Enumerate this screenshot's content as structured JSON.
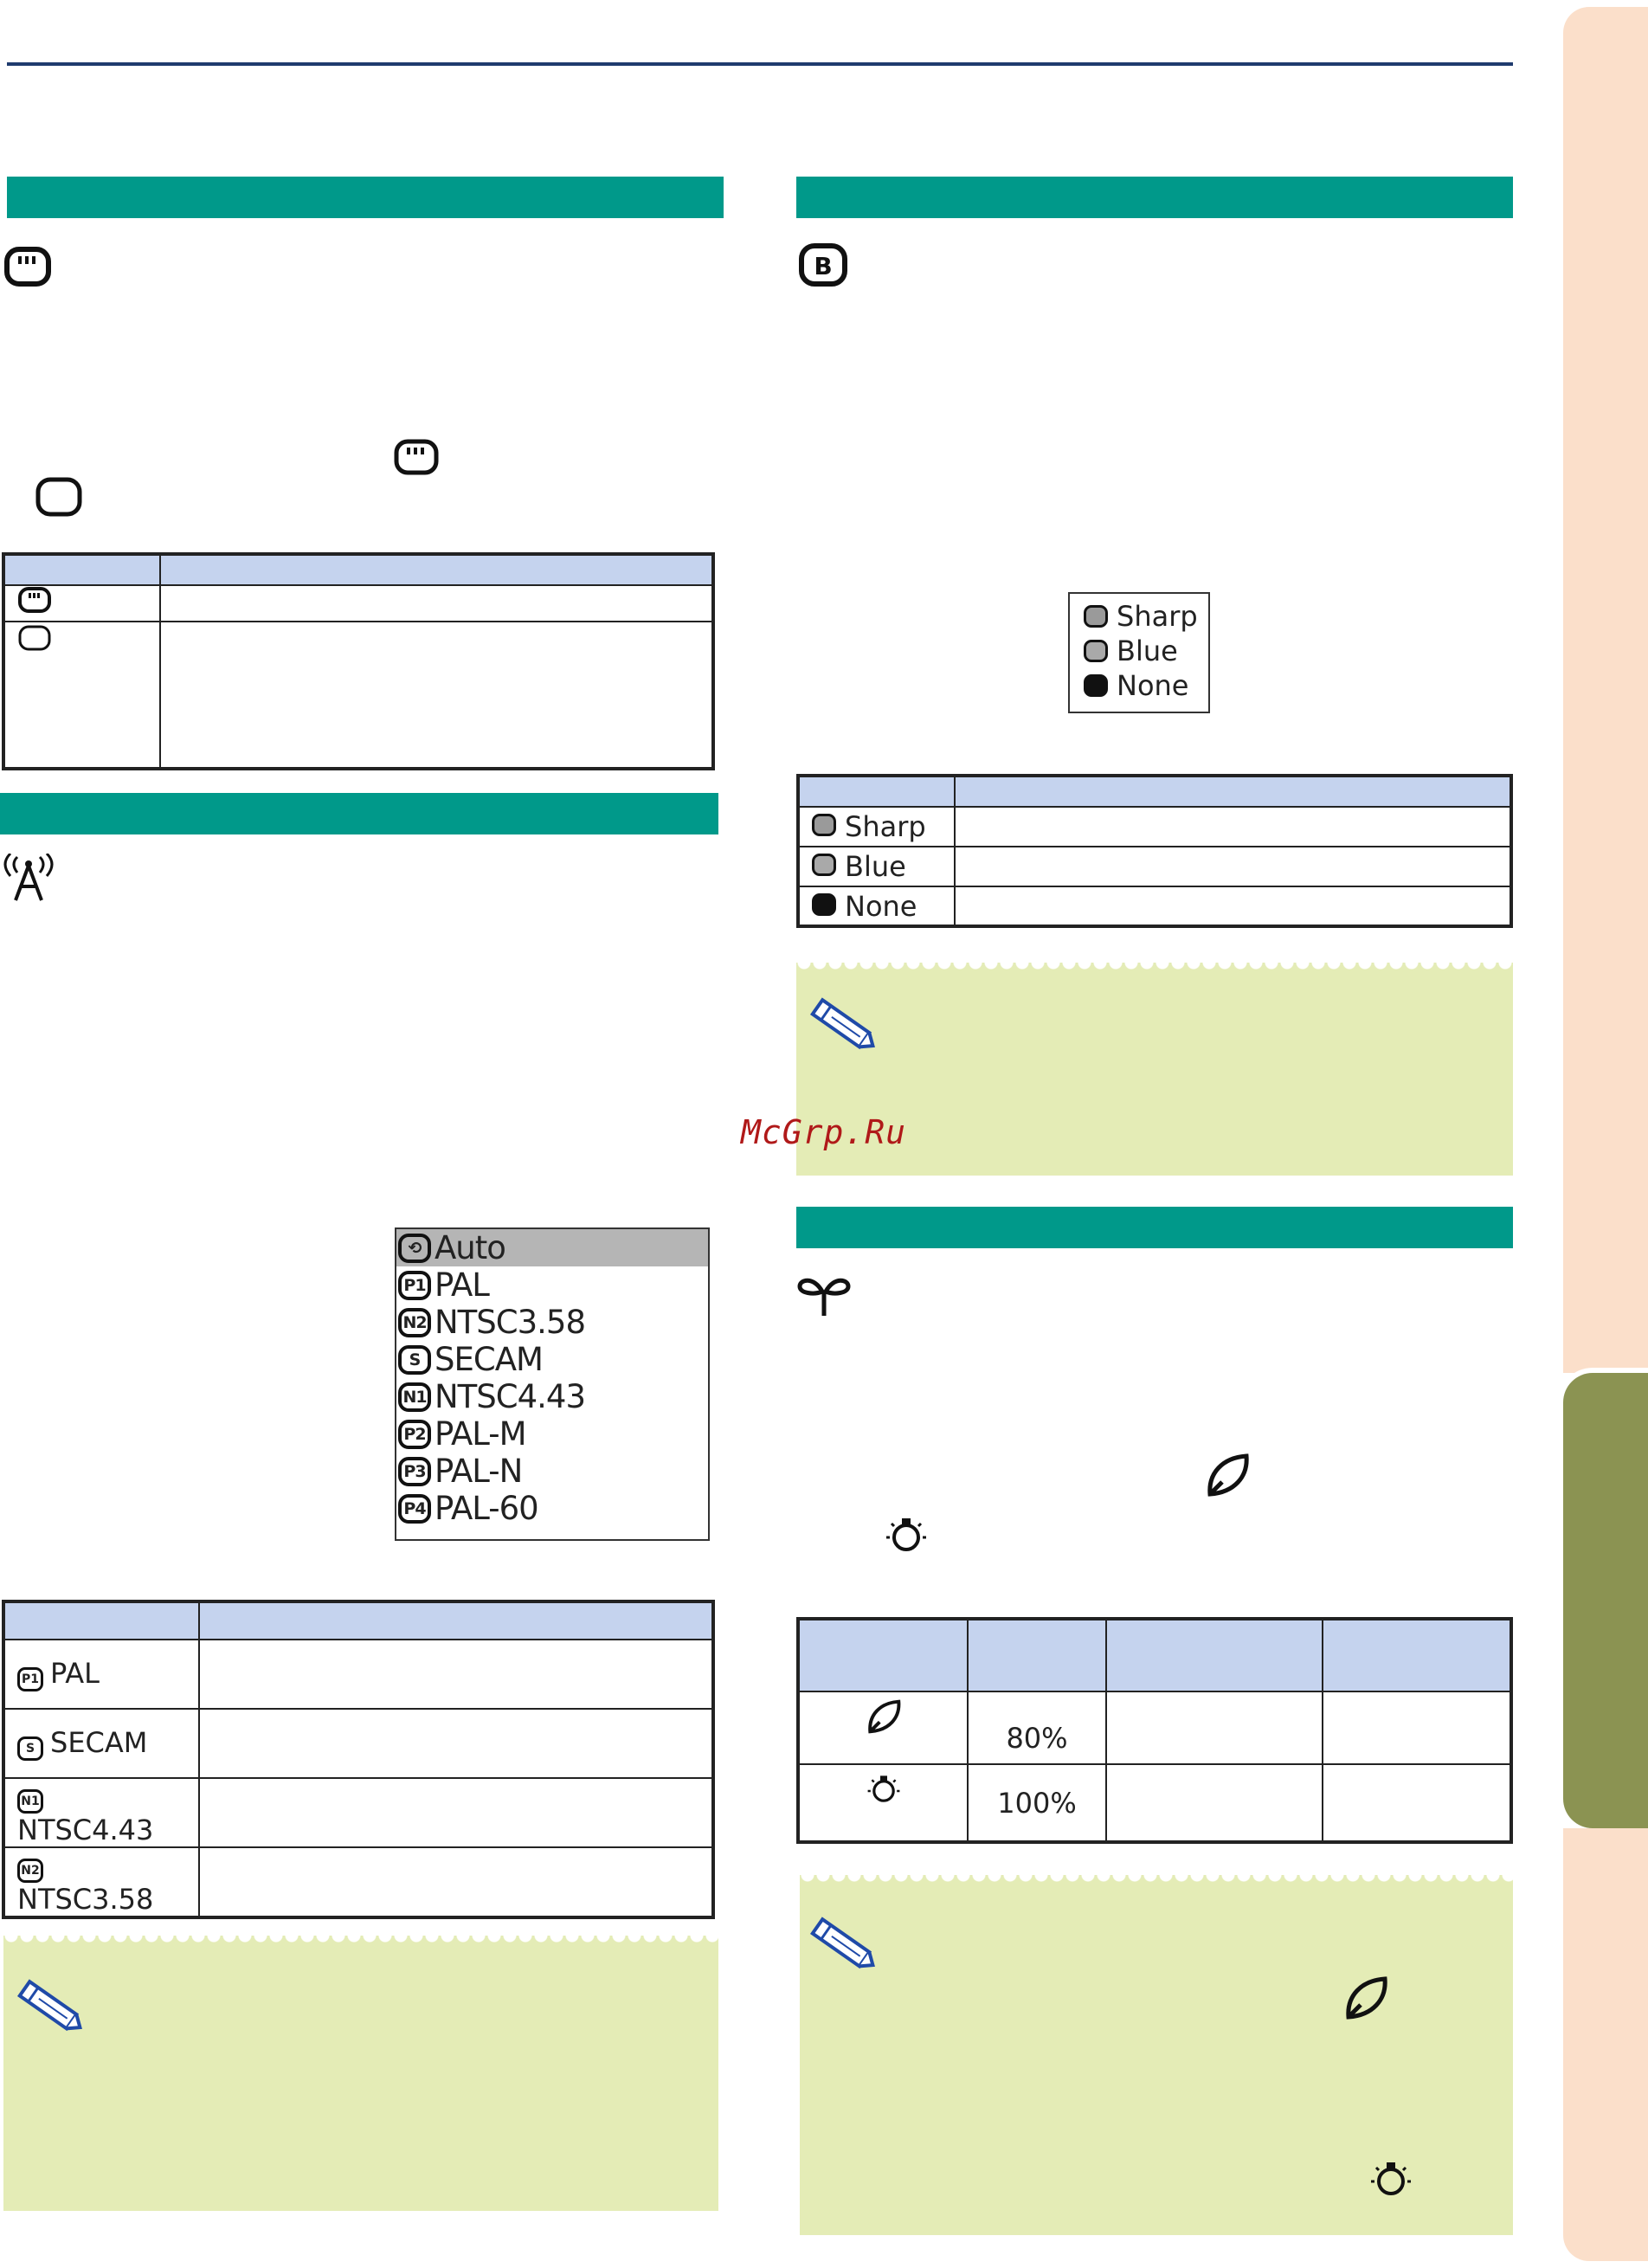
{
  "watermark": "McGrp.Ru",
  "bg_menu": {
    "items": [
      {
        "label": "Sharp",
        "icon": "sharp-logo-icon"
      },
      {
        "label": "Blue",
        "icon": "blue-square-icon"
      },
      {
        "label": "None",
        "icon": "black-square-icon"
      }
    ]
  },
  "bg_table": {
    "rows": [
      {
        "label": "Sharp",
        "icon": "sharp-logo-icon"
      },
      {
        "label": "Blue",
        "icon": "blue-square-icon"
      },
      {
        "label": "None",
        "icon": "black-square-icon"
      }
    ]
  },
  "system_menu": {
    "items": [
      {
        "badge": "⟲",
        "label": "Auto",
        "selected": true
      },
      {
        "badge": "P1",
        "label": "PAL"
      },
      {
        "badge": "N2",
        "label": "NTSC3.58"
      },
      {
        "badge": "S",
        "label": "SECAM"
      },
      {
        "badge": "N1",
        "label": "NTSC4.43"
      },
      {
        "badge": "P2",
        "label": "PAL-M"
      },
      {
        "badge": "P3",
        "label": "PAL-N"
      },
      {
        "badge": "P4",
        "label": "PAL-60"
      }
    ]
  },
  "system_table": {
    "rows": [
      {
        "badge": "P1",
        "label": "PAL"
      },
      {
        "badge": "S",
        "label": "SECAM"
      },
      {
        "badge": "N1",
        "label": "NTSC4.43"
      },
      {
        "badge": "N2",
        "label": "NTSC3.58"
      }
    ]
  },
  "eco_table": {
    "rows": [
      {
        "icon": "eco-leaf-icon",
        "value": "80%"
      },
      {
        "icon": "standard-lamp-icon",
        "value": "100%"
      }
    ]
  },
  "colors": {
    "band": "#00998a",
    "table_header": "#c5d3ee",
    "note_bg": "#e4ecb6",
    "side_tab": "#fbdfca",
    "side_tab_active": "#8b9352"
  }
}
